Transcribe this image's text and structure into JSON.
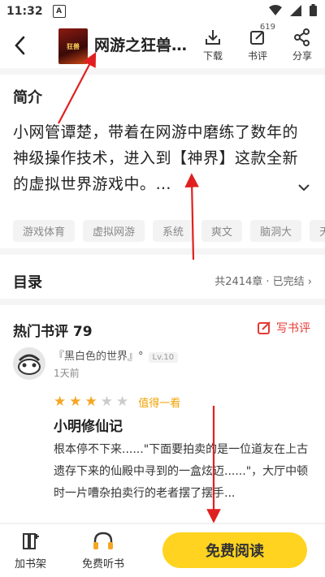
{
  "status": {
    "time": "11:32",
    "a_icon_letter": "A"
  },
  "header": {
    "cover_text": "狂兽",
    "title": "网游之狂兽…",
    "download_label": "下载",
    "review_label": "书评",
    "review_count": "619",
    "share_label": "分享"
  },
  "intro": {
    "title": "简介",
    "text": "小网管谭楚，带着在网游中磨练了数年的神级操作技术，进入到【神界】这款全新的虚拟世界游戏中。…",
    "tags": [
      "游戏体育",
      "虚拟网游",
      "系统",
      "爽文",
      "脑洞大",
      "天"
    ]
  },
  "toc": {
    "title": "目录",
    "info": "共2414章 · 已完结 ›"
  },
  "reviews": {
    "title": "热门书评 79",
    "write_label": "写书评",
    "item": {
      "user": "『黑白色的世界』°",
      "level": "Lv.10",
      "time": "1天前",
      "rating": 3,
      "max_rating": 5,
      "verdict": "值得一看",
      "book": "小明修仙记",
      "text": "根本停不下来......\"下面要拍卖的是一位道友在上古遗存下来的仙殿中寻到的一盒炫迈......\"，大厅中顿时一片嘈杂拍卖行的老者摆了摆手..."
    }
  },
  "bottom": {
    "shelf_label": "加书架",
    "listen_label": "免费听书",
    "read_label": "免费阅读"
  },
  "colors": {
    "accent": "#ffd31f",
    "star": "#f5a623",
    "red": "#e53935",
    "arrow": "#e02020"
  }
}
